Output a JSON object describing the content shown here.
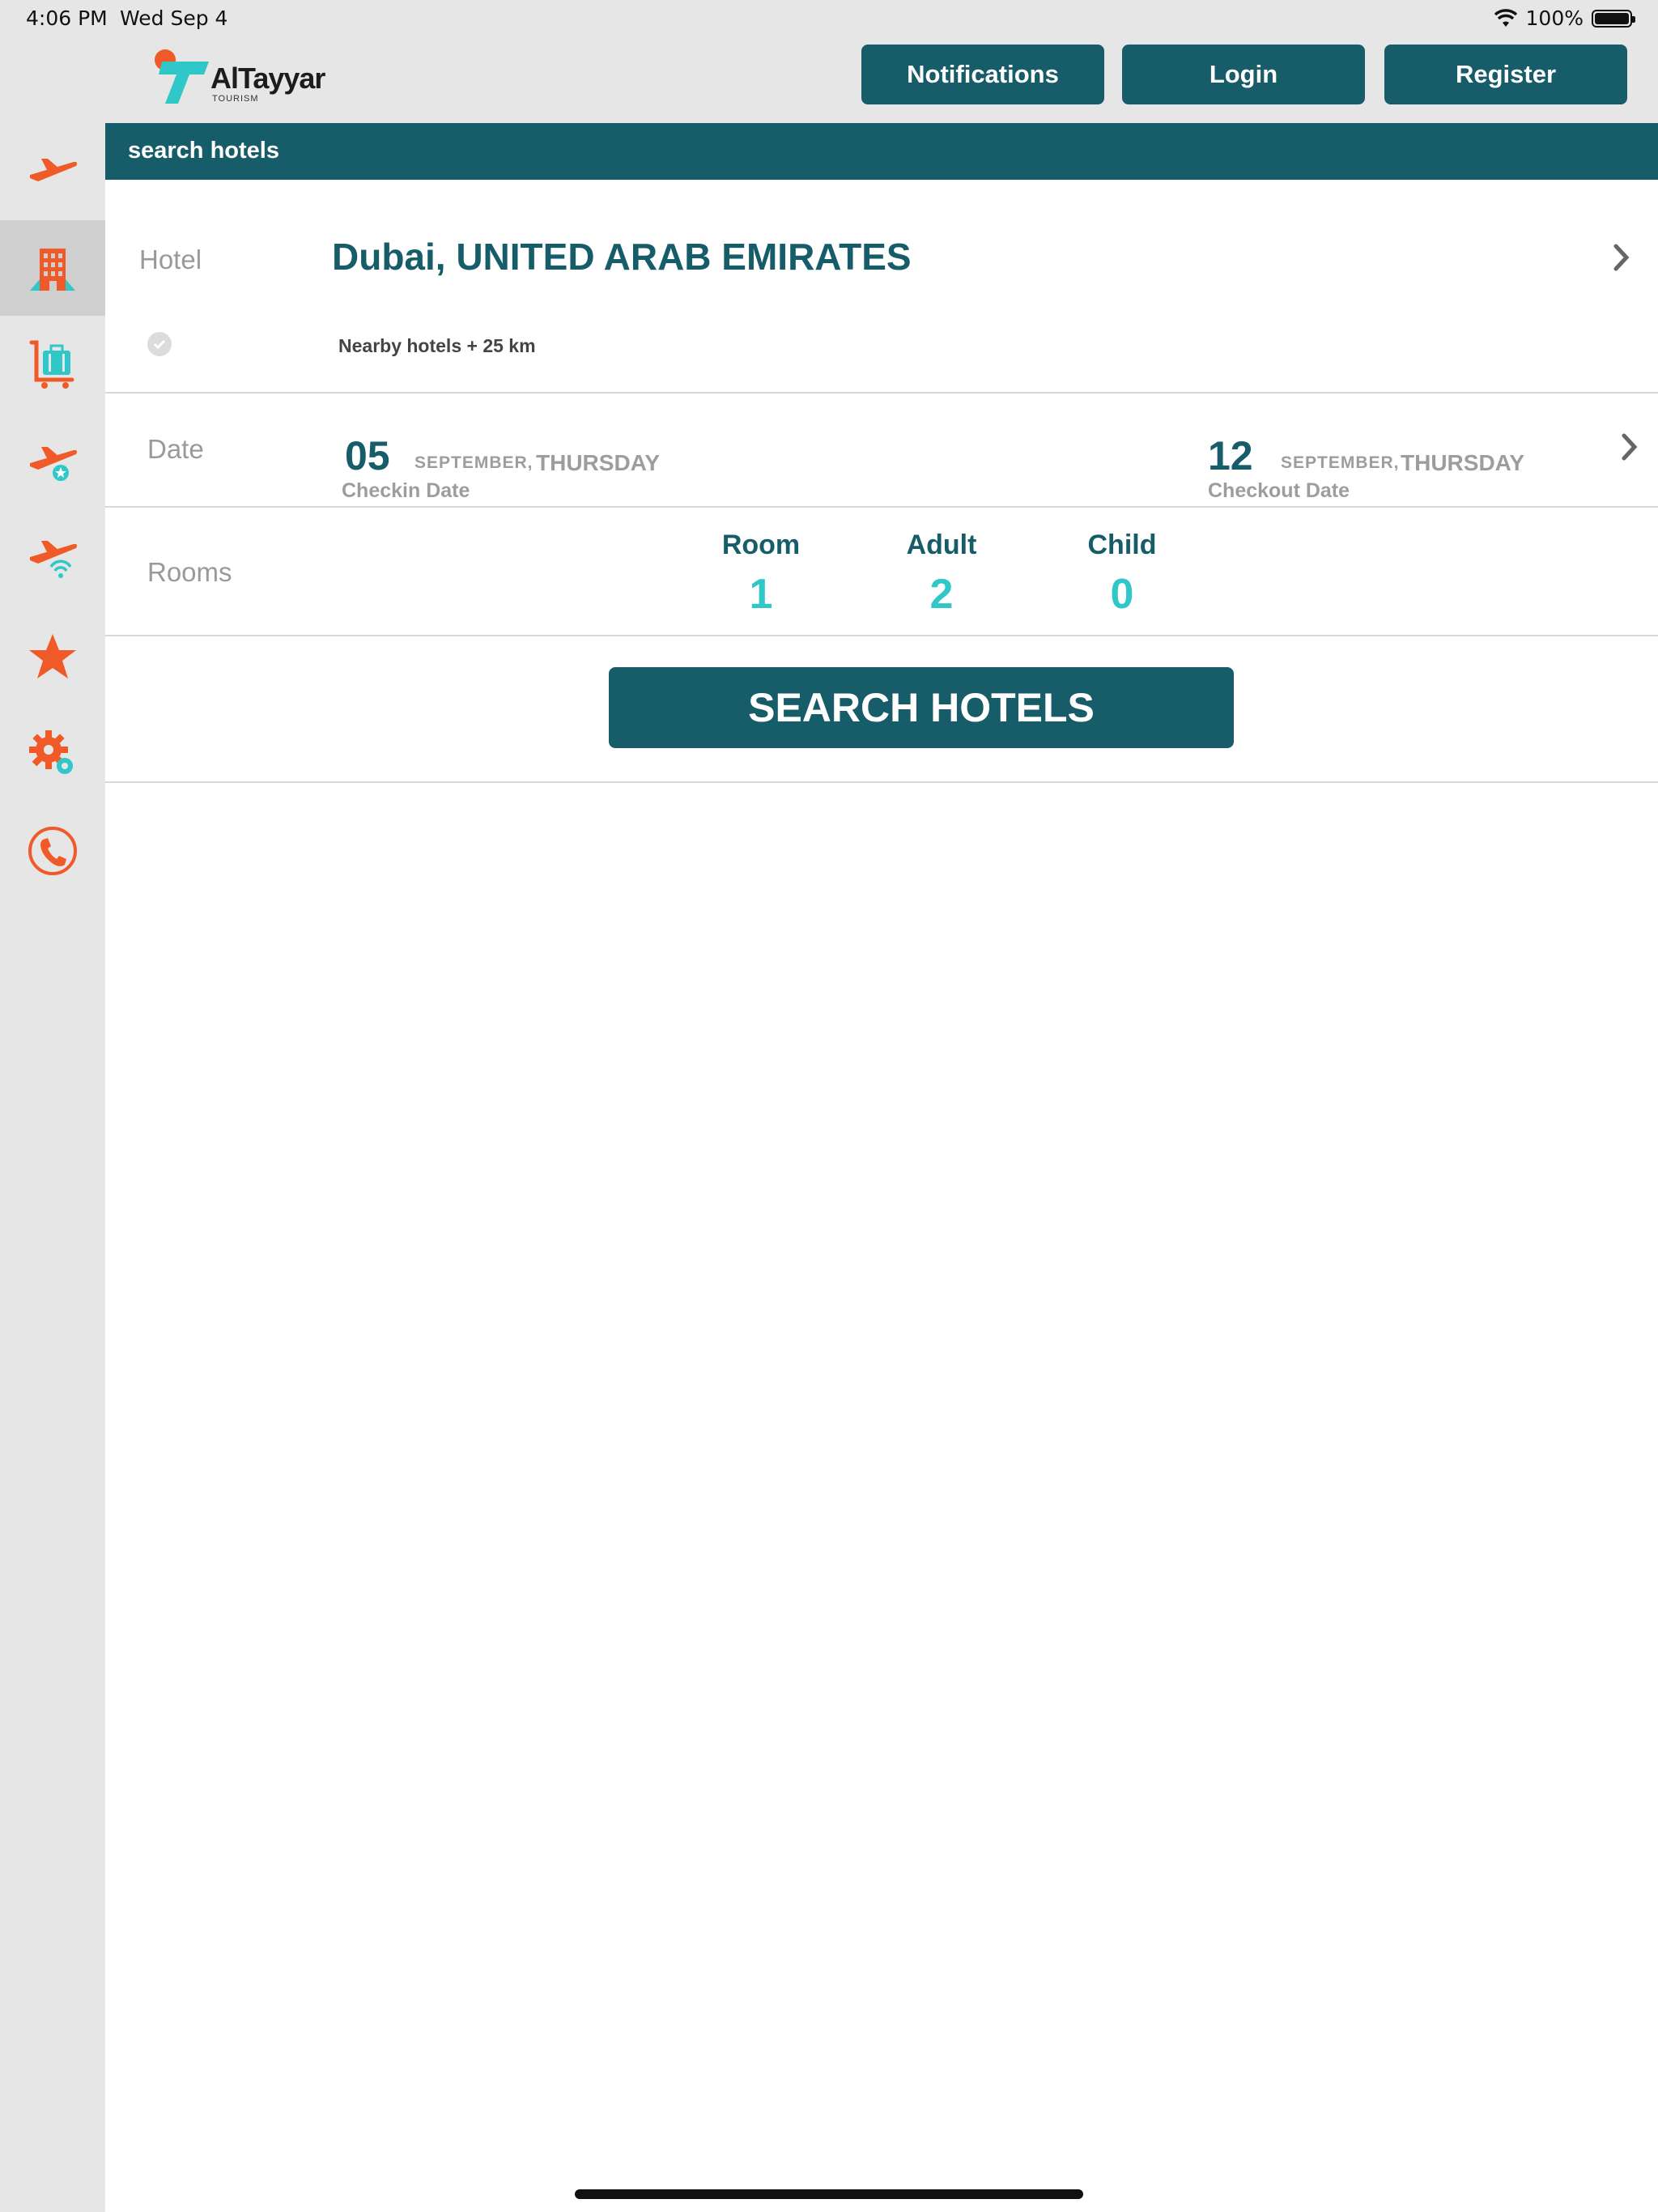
{
  "status_bar": {
    "time": "4:06 PM",
    "date": "Wed Sep 4",
    "battery": "100%"
  },
  "header": {
    "logo_text": "AlTayyar",
    "logo_sub": "TOURISM",
    "buttons": {
      "notifications": "Notifications",
      "login": "Login",
      "register": "Register"
    }
  },
  "sidebar": {
    "items": [
      {
        "name": "flights",
        "icon": "plane-icon",
        "active": false
      },
      {
        "name": "hotels",
        "icon": "hotel-building-icon",
        "active": true
      },
      {
        "name": "packages",
        "icon": "luggage-cart-icon",
        "active": false
      },
      {
        "name": "flight-offers",
        "icon": "plane-star-icon",
        "active": false
      },
      {
        "name": "flight-status",
        "icon": "plane-wifi-icon",
        "active": false
      },
      {
        "name": "favorites",
        "icon": "star-icon",
        "active": false
      },
      {
        "name": "settings",
        "icon": "gear-icon",
        "active": false
      },
      {
        "name": "contact",
        "icon": "phone-icon",
        "active": false
      }
    ]
  },
  "title_bar": {
    "title": "search hotels"
  },
  "hotel_row": {
    "label": "Hotel",
    "destination": "Dubai, UNITED ARAB EMIRATES",
    "nearby": "Nearby hotels + 25 km"
  },
  "date_row": {
    "label": "Date",
    "checkin": {
      "day": "05",
      "month": "SEPTEMBER,",
      "weekday": "THURSDAY",
      "caption": "Checkin Date"
    },
    "checkout": {
      "day": "12",
      "month": "SEPTEMBER,",
      "weekday": "THURSDAY",
      "caption": "Checkout Date"
    }
  },
  "rooms_row": {
    "label": "Rooms",
    "room": {
      "label": "Room",
      "value": "1"
    },
    "adult": {
      "label": "Adult",
      "value": "2"
    },
    "child": {
      "label": "Child",
      "value": "0"
    }
  },
  "search_button": "SEARCH HOTELS",
  "colors": {
    "primary": "#165d69",
    "accent": "#f05a28",
    "teal": "#2fc7c7",
    "muted": "#9d9d9d"
  }
}
